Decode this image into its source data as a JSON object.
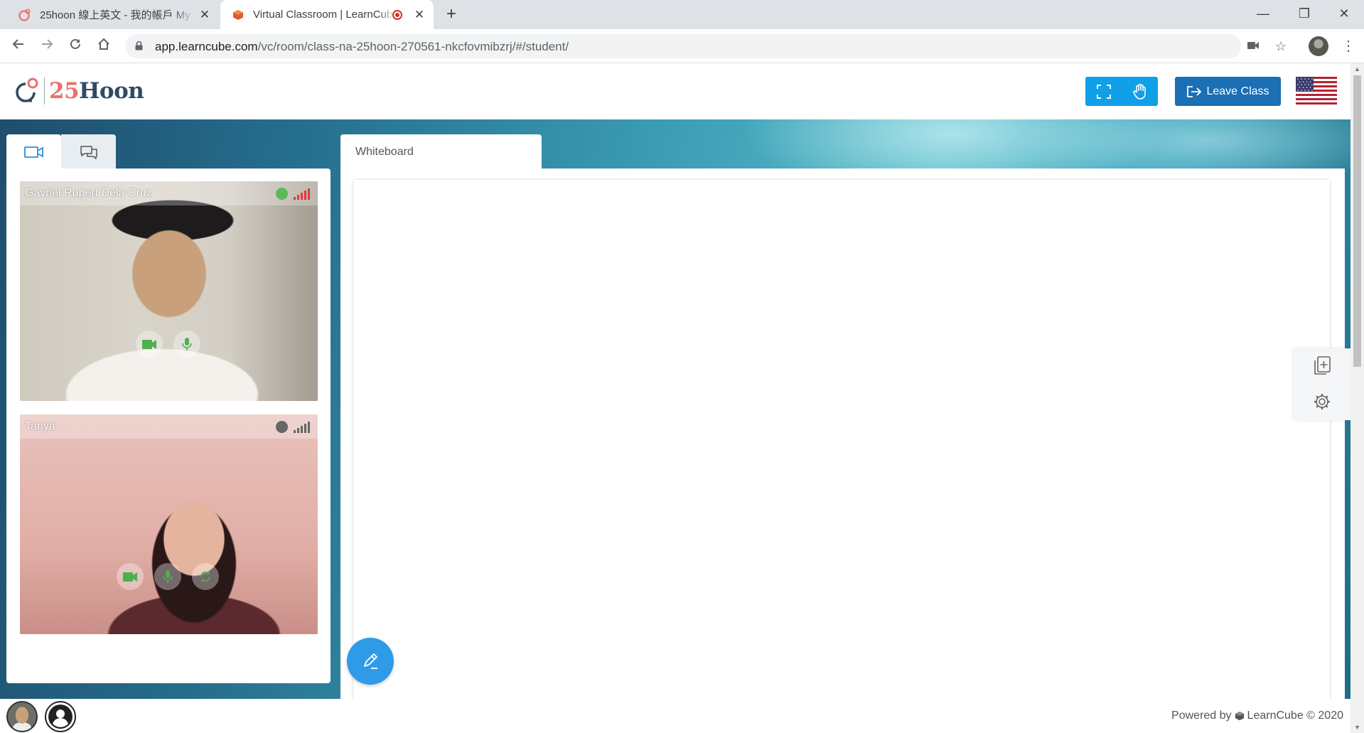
{
  "browser": {
    "tabs": [
      {
        "title": "25hoon 線上英文 - 我的帳戶 My",
        "active": false
      },
      {
        "title": "Virtual Classroom | LearnCube",
        "active": true,
        "recording": true
      }
    ],
    "new_tab_label": "+",
    "window_controls": {
      "minimize": "—",
      "maximize": "❐",
      "close": "✕"
    },
    "url_host": "app.learncube.com",
    "url_path": "/vc/room/class-na-25hoon-270561-nkcfovmibzrj/#/student/",
    "icons": [
      "back-arrow-icon",
      "forward-arrow-icon",
      "reload-icon",
      "home-icon",
      "lock-icon",
      "camera-icon",
      "star-icon",
      "kebab-menu-icon"
    ]
  },
  "header": {
    "logo_num": "25",
    "logo_word": "Hoon",
    "leave_label": "Leave Class",
    "fullscreen_icon": "fullscreen-icon",
    "raise_hand_icon": "raise-hand-icon",
    "language_flag": "us-flag-icon"
  },
  "left_panel": {
    "tabs": [
      {
        "icon": "video-camera-icon",
        "active": true
      },
      {
        "icon": "chat-bubbles-icon",
        "active": false
      }
    ],
    "participants": [
      {
        "name": "Gavriel Rupert Dela Cruz",
        "status_color": "#5cb85c",
        "signal_color": "#e53935",
        "controls": [
          "camera-icon",
          "microphone-icon"
        ]
      },
      {
        "name": "Tanya",
        "status_color": "#666666",
        "signal_color": "#666666",
        "controls": [
          "camera-icon",
          "microphone-icon",
          "refresh-icon"
        ]
      }
    ]
  },
  "whiteboard": {
    "tab_label": "Whiteboard",
    "tools": [
      "add-page-icon",
      "settings-gear-icon"
    ],
    "pen_icon": "pen-icon"
  },
  "footer": {
    "powered_prefix": "Powered by",
    "powered_brand": "LearnCube © 2020"
  },
  "colors": {
    "accent_blue": "#0fa0e8",
    "leave_blue": "#1a6fb5",
    "pen_blue": "#2f9be8",
    "control_green": "#4caf50"
  }
}
